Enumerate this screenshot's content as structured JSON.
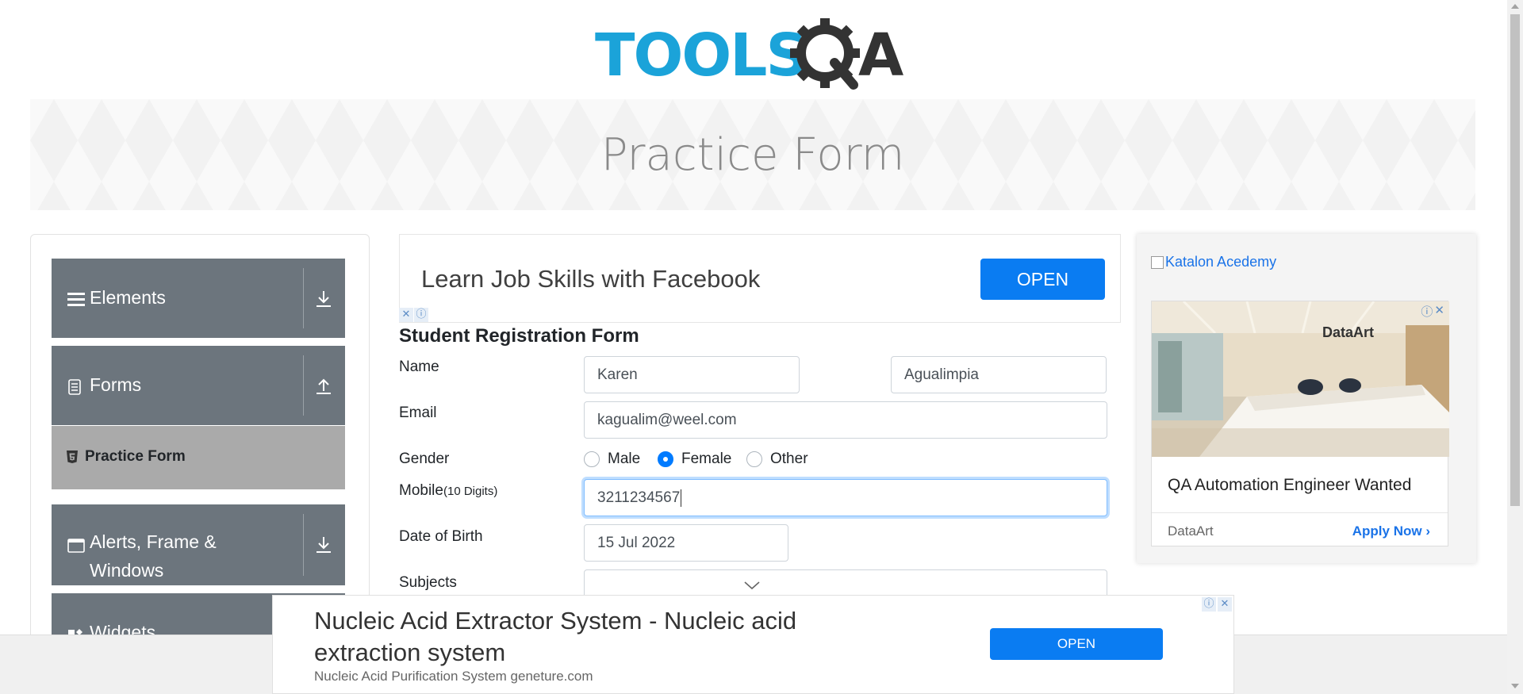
{
  "header": {
    "logo_text": "TOOLSQA",
    "logo_colors": {
      "tools": "#1ba3d9",
      "qa": "#333333"
    }
  },
  "banner": {
    "title": "Practice Form"
  },
  "sidebar": {
    "groups": [
      {
        "label": "Elements",
        "icon": "hamburger-icon",
        "arrow": "download-icon"
      },
      {
        "label": "Forms",
        "icon": "document-icon",
        "arrow": "upload-icon"
      },
      {
        "label": "Alerts, Frame &",
        "label2": "Windows",
        "icon": "window-icon",
        "arrow": "download-icon"
      },
      {
        "label": "Widgets",
        "icon": "widgets-icon"
      }
    ],
    "active_item": {
      "label": "Practice Form",
      "icon": "html5-icon"
    }
  },
  "ad_top": {
    "text": "Learn Job Skills with Facebook",
    "button": "OPEN",
    "badges": [
      "✕",
      "ⓘ"
    ]
  },
  "form": {
    "title": "Student Registration Form",
    "name_label": "Name",
    "first_name": "Karen",
    "last_name": "Agualimpia",
    "email_label": "Email",
    "email": "kagualim@weel.com",
    "gender_label": "Gender",
    "gender_options": [
      "Male",
      "Female",
      "Other"
    ],
    "gender_selected": "Female",
    "mobile_label": "Mobile",
    "mobile_hint": "(10 Digits)",
    "mobile": "3211234567",
    "dob_label": "Date of Birth",
    "dob": "15 Jul 2022",
    "subjects_label": "Subjects"
  },
  "ad_right": {
    "broken_image_alt": "Katalon Acedemy",
    "photo_brand": "DataArt",
    "headline": "QA Automation Engineer Wanted",
    "brand": "DataArt",
    "cta": "Apply Now",
    "cta_arrow": "›"
  },
  "ad_bottom": {
    "title": "Nucleic Acid Extractor System - Nucleic acid extraction system",
    "subtitle": "Nucleic Acid Purification System geneture.com",
    "button": "OPEN"
  },
  "colors": {
    "accent": "#007bff",
    "sidebar_group": "#6c757d",
    "sidebar_active": "#aaaaaa",
    "ad_button": "#0a7cf2"
  }
}
